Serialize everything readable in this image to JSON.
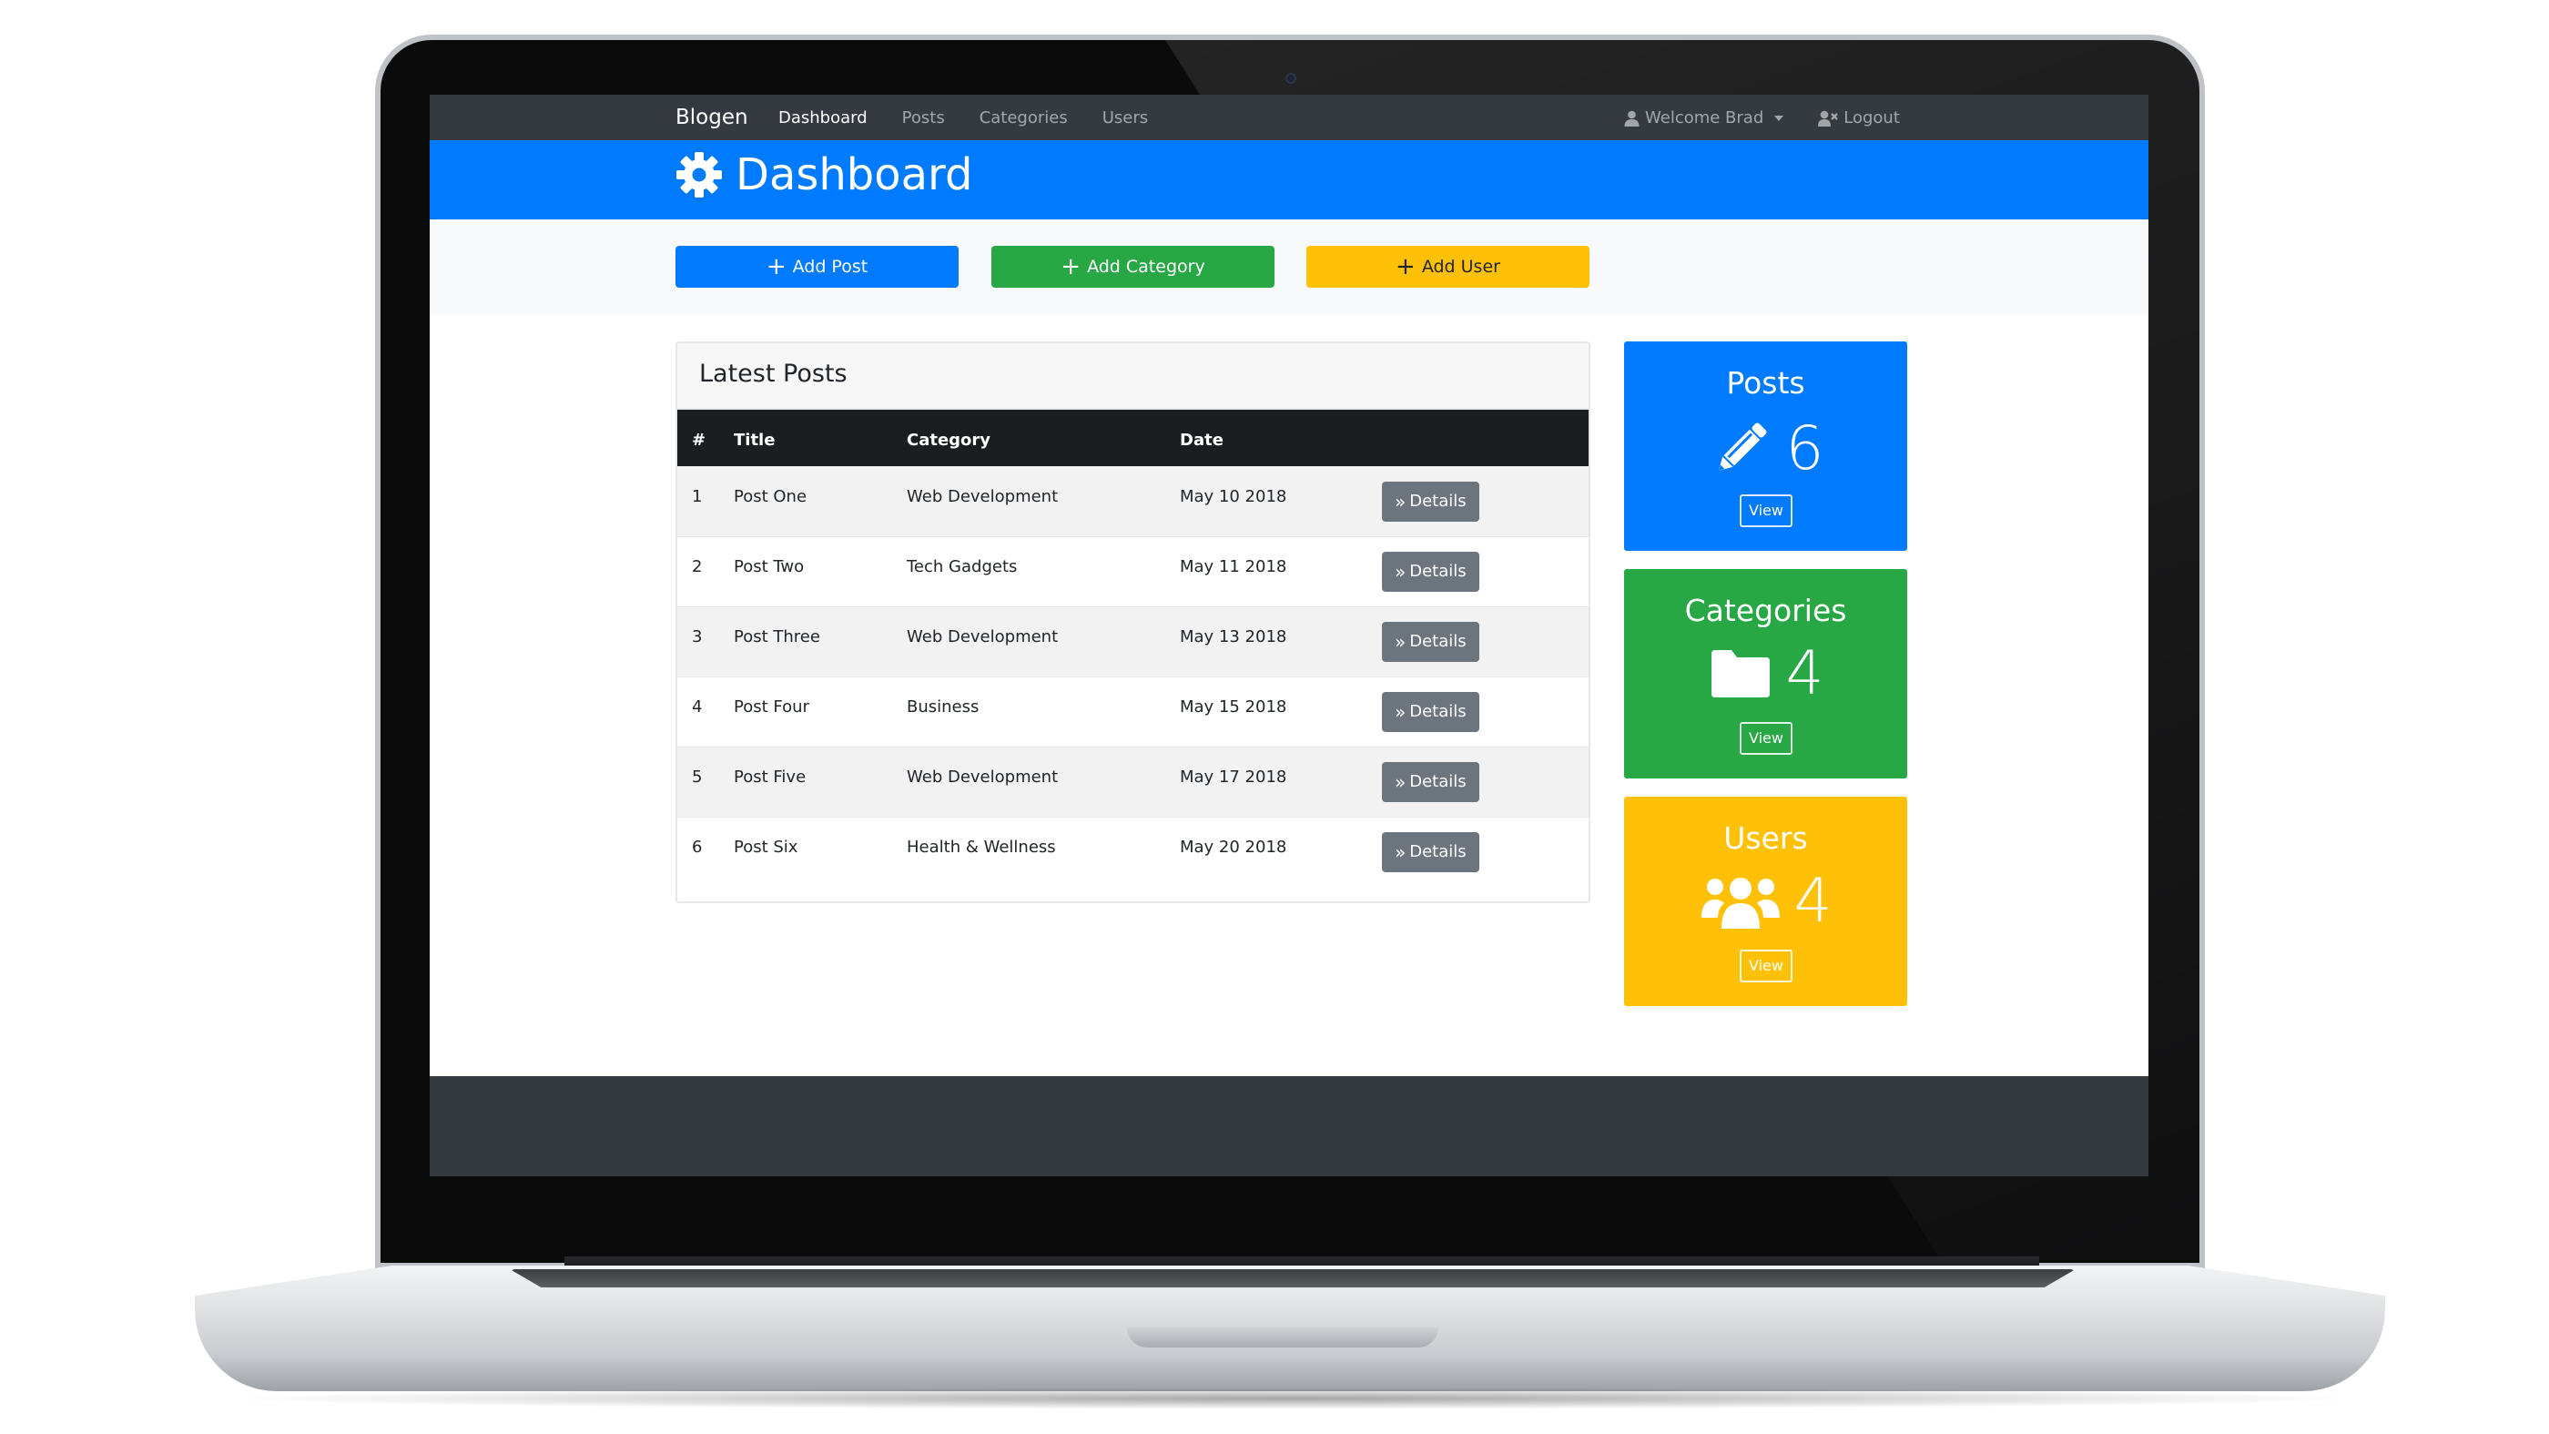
{
  "navbar": {
    "brand": "Blogen",
    "links": [
      "Dashboard",
      "Posts",
      "Categories",
      "Users"
    ],
    "welcome": "Welcome Brad",
    "logout": "Logout"
  },
  "header": {
    "title": "Dashboard",
    "icon": "gear-icon"
  },
  "actions": {
    "add_post": "Add Post",
    "add_category": "Add Category",
    "add_user": "Add User"
  },
  "latest_posts": {
    "title": "Latest Posts",
    "columns": [
      "#",
      "Title",
      "Category",
      "Date"
    ],
    "details_label": "Details",
    "rows": [
      {
        "num": "1",
        "title": "Post One",
        "category": "Web Development",
        "date": "May 10 2018"
      },
      {
        "num": "2",
        "title": "Post Two",
        "category": "Tech Gadgets",
        "date": "May 11 2018"
      },
      {
        "num": "3",
        "title": "Post Three",
        "category": "Web Development",
        "date": "May 13 2018"
      },
      {
        "num": "4",
        "title": "Post Four",
        "category": "Business",
        "date": "May 15 2018"
      },
      {
        "num": "5",
        "title": "Post Five",
        "category": "Web Development",
        "date": "May 17 2018"
      },
      {
        "num": "6",
        "title": "Post Six",
        "category": "Health & Wellness",
        "date": "May 20 2018"
      }
    ]
  },
  "stats": {
    "posts": {
      "title": "Posts",
      "count": "6",
      "view": "View",
      "color": "#007bff",
      "icon": "pencil-icon"
    },
    "categories": {
      "title": "Categories",
      "count": "4",
      "view": "View",
      "color": "#28a745",
      "icon": "folder-icon"
    },
    "users": {
      "title": "Users",
      "count": "4",
      "view": "View",
      "color": "#ffc107",
      "icon": "users-icon"
    }
  },
  "colors": {
    "primary": "#007bff",
    "success": "#28a745",
    "warning": "#ffc107",
    "secondary": "#6c757d",
    "dark": "#343a40"
  }
}
